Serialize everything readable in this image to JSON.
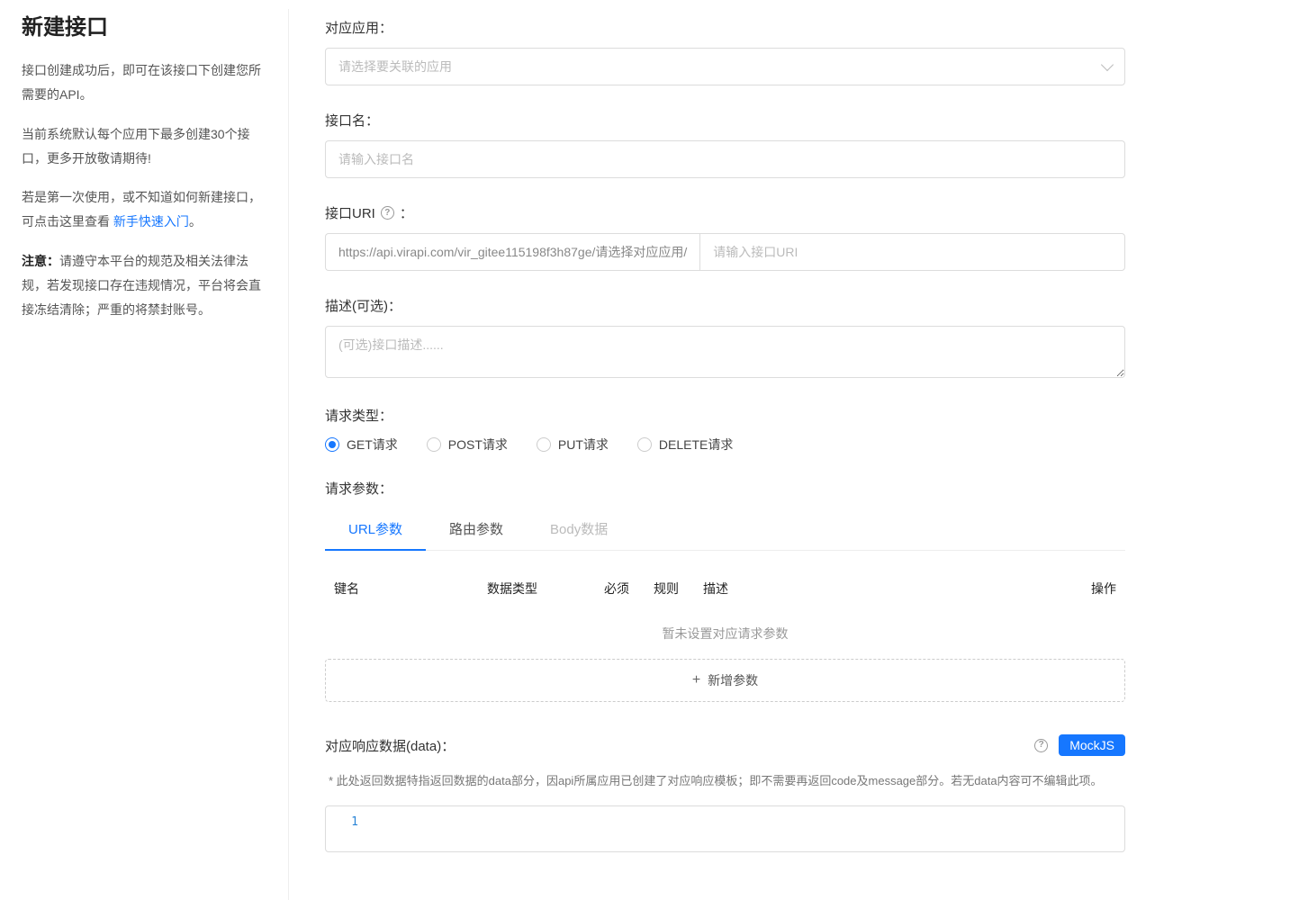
{
  "sidebar": {
    "title": "新建接口",
    "p1": "接口创建成功后，即可在该接口下创建您所需要的API。",
    "p2": "当前系统默认每个应用下最多创建30个接口，更多开放敬请期待!",
    "p3_prefix": "若是第一次使用，或不知道如何新建接口，可点击这里查看 ",
    "p3_link": "新手快速入门",
    "p3_suffix": "。",
    "p4_prefix": "注意：",
    "p4_body": "请遵守本平台的规范及相关法律法规，若发现接口存在违规情况，平台将会直接冻结清除；严重的将禁封账号。"
  },
  "form": {
    "app": {
      "label": "对应应用",
      "placeholder": "请选择要关联的应用"
    },
    "name": {
      "label": "接口名",
      "placeholder": "请输入接口名"
    },
    "uri": {
      "label": "接口URI",
      "prefix": "https://api.virapi.com/vir_gitee115198f3h87ge/请选择对应应用/",
      "placeholder": "请输入接口URI"
    },
    "desc": {
      "label": "描述(可选)",
      "placeholder": "(可选)接口描述......"
    },
    "method": {
      "label": "请求类型",
      "options": [
        "GET请求",
        "POST请求",
        "PUT请求",
        "DELETE请求"
      ],
      "selected": 0
    },
    "params": {
      "label": "请求参数",
      "tabs": [
        {
          "label": "URL参数",
          "state": "active"
        },
        {
          "label": "路由参数",
          "state": "normal"
        },
        {
          "label": "Body数据",
          "state": "disabled"
        }
      ],
      "columns": [
        "键名",
        "数据类型",
        "必须",
        "规则",
        "描述",
        "操作"
      ],
      "empty": "暂未设置对应请求参数",
      "add": "新增参数"
    },
    "response": {
      "label": "对应响应数据(data)",
      "mock_tag": "MockJS",
      "footnote": "* 此处返回数据特指返回数据的data部分，因api所属应用已创建了对应响应模板；即不需要再返回code及message部分。若无data内容可不编辑此项。",
      "line_no": "1"
    }
  }
}
